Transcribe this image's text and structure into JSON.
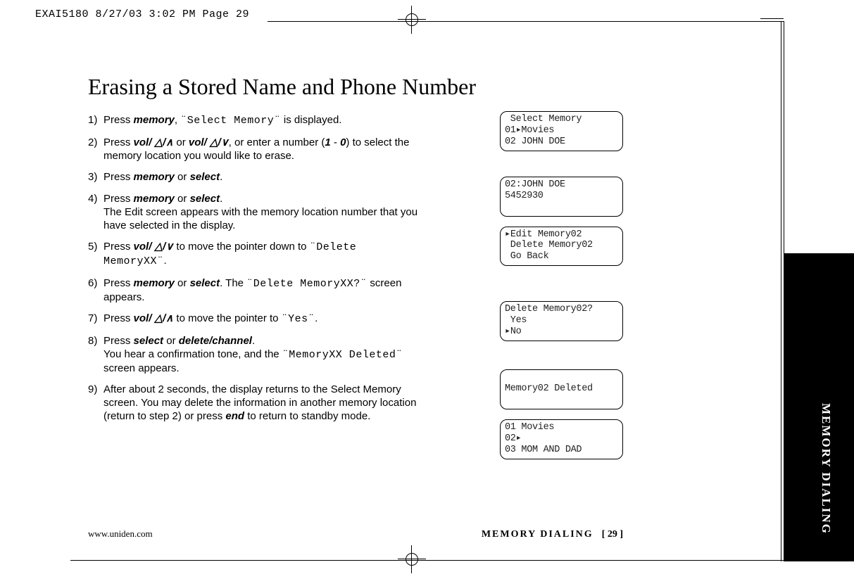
{
  "header_stamp": "EXAI5180  8/27/03 3:02 PM  Page 29",
  "title": "Erasing a Stored Name and Phone Number",
  "tab_label": "MEMORY DIALING",
  "footer": {
    "url": "www.uniden.com",
    "section": "MEMORY DIALING",
    "page": "[ 29 ]"
  },
  "steps": {
    "s1": {
      "num": "1)",
      "a": "Press ",
      "key1": "memory",
      "b": ", ",
      "lcd": "¨Select Memory¨",
      "c": " is displayed."
    },
    "s2": {
      "num": "2)",
      "a": "Press ",
      "key1": "vol/ ",
      "kup": "/",
      "b": " or ",
      "key2": "vol/ ",
      "kdn": "/",
      "c": ", or enter a number (",
      "bold1": "1",
      "d": " - ",
      "bold2": "0",
      "e": ") to select the memory location you would like to erase."
    },
    "s3": {
      "num": "3)",
      "a": "Press ",
      "key1": "memory",
      "b": " or ",
      "key2": "select",
      "c": "."
    },
    "s4": {
      "num": "4)",
      "a": "Press ",
      "key1": "memory",
      "b": " or ",
      "key2": "select",
      "c": ".",
      "body": "The Edit screen appears with the memory location number that you have selected in the display."
    },
    "s5": {
      "num": "5)",
      "a": "Press ",
      "key1": "vol/ ",
      "kdn": "/",
      "b": " to move the pointer down to ",
      "lcd": "¨Delete MemoryXX¨",
      "c": "."
    },
    "s6": {
      "num": "6)",
      "a": "Press ",
      "key1": "memory",
      "b": " or ",
      "key2": "select",
      "c": ". The ",
      "lcd": "¨Delete MemoryXX?¨",
      "d": " screen appears."
    },
    "s7": {
      "num": "7)",
      "a": "Press ",
      "key1": "vol/ ",
      "kup": "/",
      "b": " to move the pointer to ",
      "lcd": "¨Yes¨",
      "c": "."
    },
    "s8": {
      "num": "8)",
      "a": "Press ",
      "key1": "select",
      "b": " or ",
      "key2": "delete/channel",
      "c": ".",
      "body1": "You hear a confirmation tone, and the ",
      "lcd": "¨MemoryXX Deleted¨",
      "body2": " screen appears."
    },
    "s9": {
      "num": "9)",
      "body1": "After about 2 seconds, the display returns to the Select Memory screen. You may delete the information in another memory location (return to step 2) or press ",
      "key1": "end",
      "body2": " to return to standby mode."
    }
  },
  "screens": {
    "sc1": " Select Memory\n01▸Movies\n02 JOHN DOE",
    "sc2": "02:JOHN DOE\n5452930\n ",
    "sc3": "▸Edit Memory02\n Delete Memory02\n Go Back",
    "sc4": "Delete Memory02?\n Yes\n▸No",
    "sc5": "\nMemory02 Deleted\n ",
    "sc6": "01 Movies\n02▸\n03 MOM AND DAD"
  },
  "glyphs": {
    "ring": "△",
    "up": "∧",
    "down": "∨"
  }
}
